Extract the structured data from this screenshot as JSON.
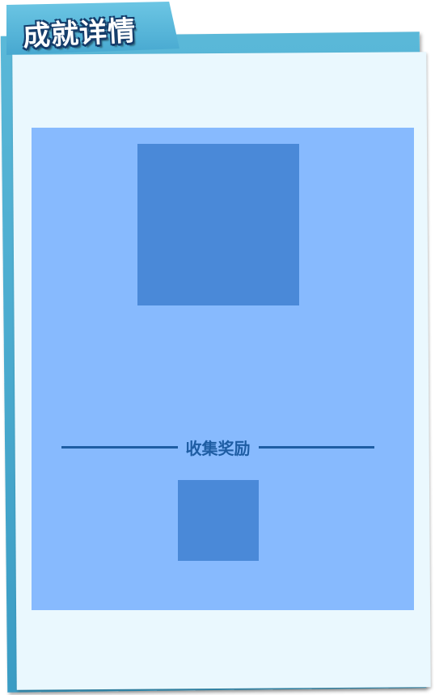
{
  "header": {
    "title": "成就详情"
  },
  "detail": {
    "reward_section_title": "收集奖励"
  },
  "colors": {
    "frame": "#47a8d0",
    "panel": "#eaf8fe",
    "content": "#87bafe",
    "icon_placeholder": "#4a89d8",
    "accent_text": "#1e5da3"
  }
}
